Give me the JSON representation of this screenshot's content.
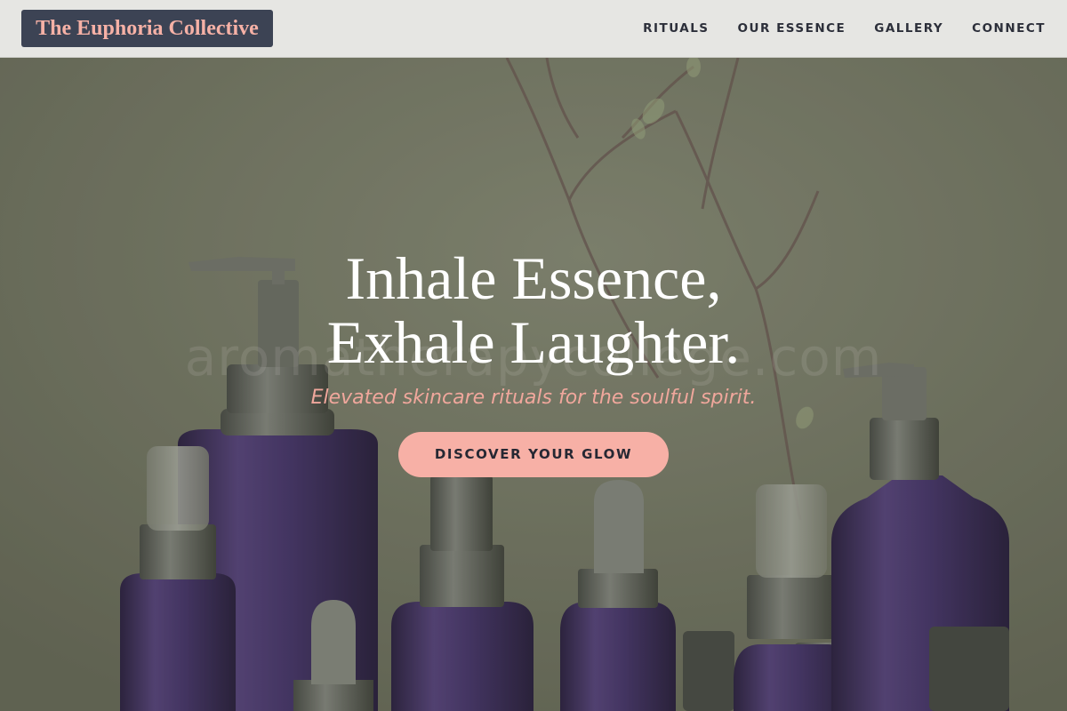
{
  "header": {
    "brand": "The Euphoria Collective",
    "nav": [
      {
        "label": "RITUALS"
      },
      {
        "label": "OUR ESSENCE"
      },
      {
        "label": "GALLERY"
      },
      {
        "label": "CONNECT"
      }
    ]
  },
  "hero": {
    "title_line1": "Inhale Essence,",
    "title_line2": "Exhale Laughter.",
    "subtitle": "Elevated skincare rituals for the soulful spirit.",
    "cta_label": "DISCOVER YOUR GLOW",
    "watermark": "aromatherapycollege.com",
    "background_description": "purple and amber glass bottles with pump and dropper caps in front of dried branches"
  },
  "colors": {
    "header_bg": "#e6e6e3",
    "brand_bg": "#3c4354",
    "brand_text": "#f6b1a6",
    "nav_text": "#2c2f3a",
    "hero_bg": "#7d7f6c",
    "accent": "#f7b0a6",
    "subtitle_text": "#f0a79c",
    "bottle_purple": "#4e3a70"
  }
}
